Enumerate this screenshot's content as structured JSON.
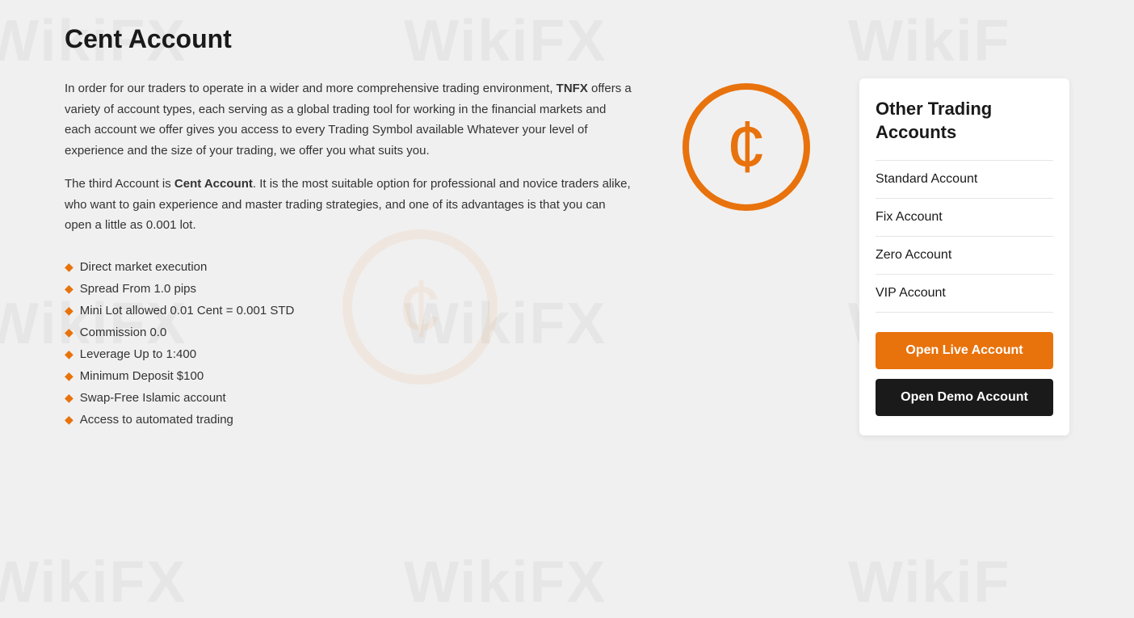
{
  "page": {
    "title": "Cent Account",
    "watermarks": [
      "WikiFX",
      "WikiF"
    ]
  },
  "intro": {
    "paragraph1_prefix": "In order for our traders to operate in a wider and more comprehensive trading environment, ",
    "brand": "TNFX",
    "paragraph1_suffix": " offers a variety of account types, each serving as a global trading tool for working in the financial markets and each account we offer gives you access to every Trading Symbol available Whatever your level of experience and the size of your trading, we offer you what suits you.",
    "paragraph2_prefix": "The third Account is ",
    "paragraph2_brand": "Cent Account",
    "paragraph2_suffix": ". It is the most suitable option for professional and novice traders alike, who want to gain experience and master trading strategies, and one of its advantages is that you can open a little as 0.001 lot."
  },
  "features": [
    {
      "text": "Direct market execution"
    },
    {
      "text": "Spread From 1.0 pips"
    },
    {
      "text": "Mini Lot allowed 0.01 Cent = 0.001 STD"
    },
    {
      "text": "Commission 0.0"
    },
    {
      "text": "Leverage Up to 1:400"
    },
    {
      "text": "Minimum Deposit $100"
    },
    {
      "text": "Swap-Free Islamic account"
    },
    {
      "text": "Access to automated trading"
    }
  ],
  "sidebar": {
    "title": "Other Trading Accounts",
    "account_links": [
      {
        "label": "Standard Account"
      },
      {
        "label": "Fix Account"
      },
      {
        "label": "Zero Account"
      },
      {
        "label": "VIP Account"
      }
    ],
    "btn_live": "Open Live Account",
    "btn_demo": "Open Demo Account"
  }
}
